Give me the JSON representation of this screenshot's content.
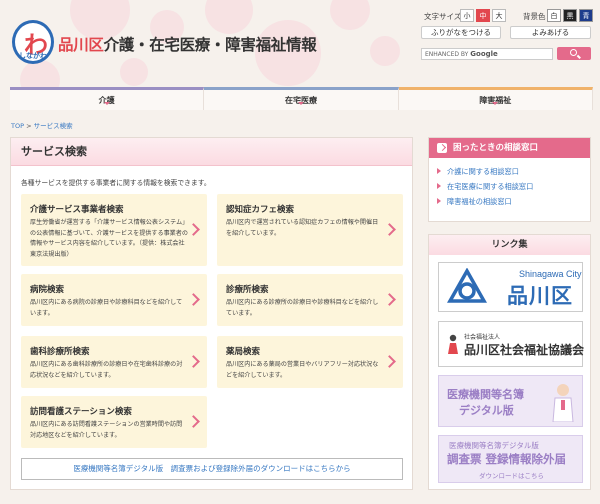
{
  "header": {
    "logo_mark": "わ",
    "logo_sub": "しながわ",
    "title_ward": "品川区",
    "title_rest": "介護・在宅医療・障害福祉情報",
    "font_size_label": "文字サイズ",
    "font_sizes": [
      "小",
      "中",
      "大"
    ],
    "bg_color_label": "背景色",
    "bg_colors": [
      "白",
      "黒",
      "青"
    ],
    "furigana_button": "ふりがなをつける",
    "readaloud_button": "よみあげる",
    "search_placeholder_brand": "ENHANCED BY",
    "search_placeholder_google": "Google"
  },
  "nav": {
    "items": [
      "介護",
      "在宅医療",
      "障害福祉"
    ]
  },
  "breadcrumb": {
    "top": "TOP",
    "sep": " > ",
    "current": "サービス検索"
  },
  "main": {
    "heading": "サービス検索",
    "intro": "各種サービスを提供する事業者に関する情報を検索できます。",
    "cards": [
      {
        "title": "介護サービス事業者検索",
        "desc": "厚生労働省が運営する「介護サービス情報公表システム」の公表情報に基づいて、介護サービスを提供する事業者の情報やサービス内容を紹介しています。（提供：株式会社東京法規出版）"
      },
      {
        "title": "認知症カフェ検索",
        "desc": "品川区内で運営されている認知症カフェの情報や開催日を紹介しています。"
      },
      {
        "title": "病院検索",
        "desc": "品川区内にある病院の診療日や診療科目などを紹介しています。"
      },
      {
        "title": "診療所検索",
        "desc": "品川区内にある診療所の診療日や診療科目などを紹介しています。"
      },
      {
        "title": "歯科診療所検索",
        "desc": "品川区内にある歯科診療所の診療日や在宅歯科診療の対応状況などを紹介しています。"
      },
      {
        "title": "薬局検索",
        "desc": "品川区内にある薬局の営業日やバリアフリー対応状況などを紹介しています。"
      },
      {
        "title": "訪問看護ステーション検索",
        "desc": "品川区内にある訪問看護ステーションの営業時間や訪問対応地区などを紹介しています。"
      }
    ],
    "download_link": "医療機関等名簿デジタル版　調査票および登録除外届のダウンロードはこちらから"
  },
  "consult": {
    "heading": "困ったときの相談窓口",
    "links": [
      "介護に関する相談窓口",
      "在宅医療に関する相談窓口",
      "障害福祉の相談窓口"
    ]
  },
  "links_box": {
    "heading": "リンク集",
    "shinagawa_city_en": "Shinagawa City",
    "shinagawa_city_jp": "品川区",
    "council_small": "社会福祉法人",
    "council_name": "品川区社会福祉協議会",
    "banner3_line1": "医療機関等名簿",
    "banner3_line2": "デジタル版",
    "banner4_line1": "医療機関等名簿デジタル版",
    "banner4_line2": "調査票 登録情報除外届",
    "banner4_line3": "ダウンロードはこちら"
  },
  "colors": {
    "accent": "#e46a8b",
    "brand_blue": "#2d6bb5",
    "card_bg": "#fdf5db",
    "link": "#3778c2"
  }
}
